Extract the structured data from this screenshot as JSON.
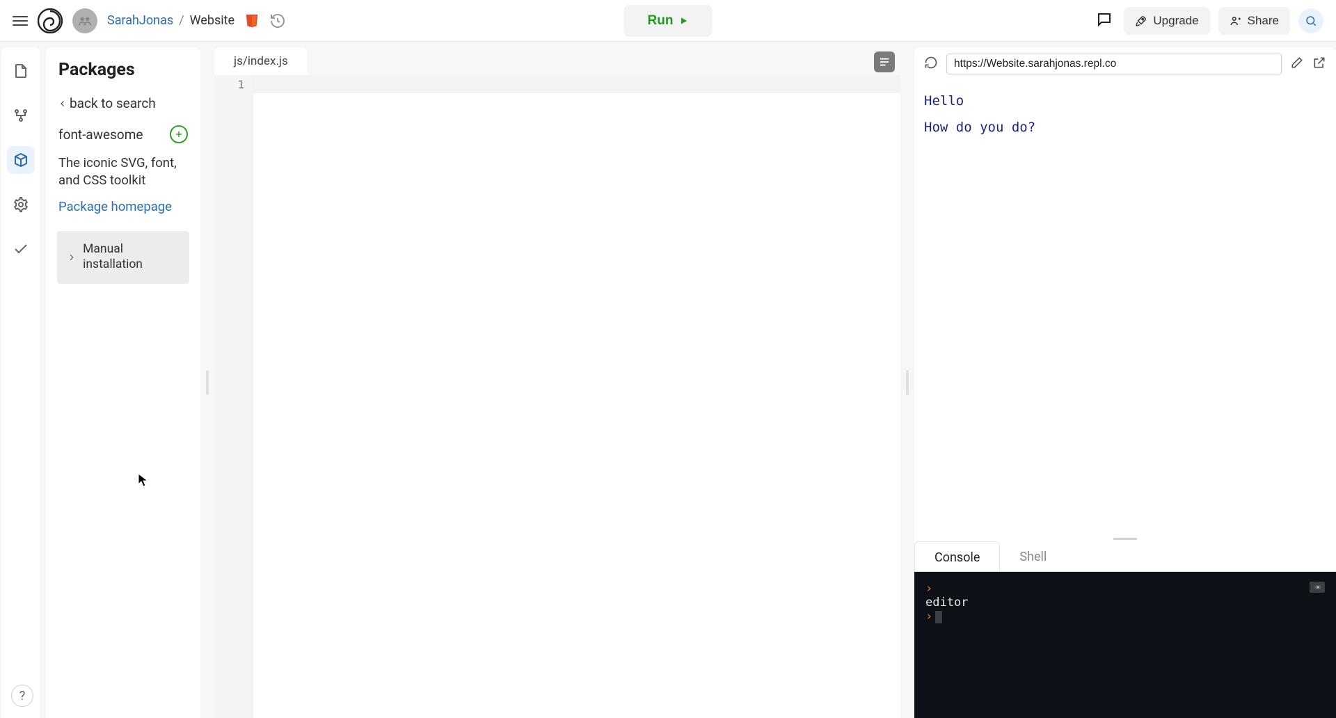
{
  "header": {
    "user": "SarahJonas",
    "sep": "/",
    "project": "Website",
    "run_label": "Run",
    "upgrade_label": "Upgrade",
    "share_label": "Share"
  },
  "sidebar_panel": {
    "title": "Packages",
    "back_label": "back to search",
    "package_name": "font-awesome",
    "package_desc": "The iconic SVG, font, and CSS toolkit",
    "homepage_link": "Package homepage",
    "manual_label": "Manual installation"
  },
  "editor": {
    "tab_label": "js/index.js",
    "line_number": "1"
  },
  "preview": {
    "url": "https://Website.sarahjonas.repl.co",
    "lines": {
      "l1": "Hello",
      "l2": "How do you do?"
    }
  },
  "console": {
    "tab_console": "Console",
    "tab_shell": "Shell",
    "output_line": "editor"
  },
  "help": "?"
}
